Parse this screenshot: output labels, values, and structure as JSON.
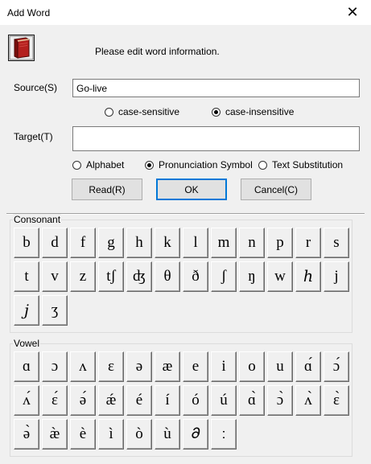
{
  "window": {
    "title": "Add Word",
    "close_label": "✕"
  },
  "header": {
    "prompt": "Please edit word information."
  },
  "source": {
    "label": "Source(S)",
    "value": "Go-live"
  },
  "case_options": [
    {
      "label": "case-sensitive",
      "selected": false
    },
    {
      "label": "case-insensitive",
      "selected": true
    }
  ],
  "target": {
    "label": "Target(T)",
    "value": ""
  },
  "type_options": [
    {
      "label": "Alphabet",
      "selected": false
    },
    {
      "label": "Pronunciation Symbol",
      "selected": true
    },
    {
      "label": "Text Substitution",
      "selected": false
    }
  ],
  "buttons": {
    "read": "Read(R)",
    "ok": "OK",
    "cancel": "Cancel(C)"
  },
  "consonant": {
    "title": "Consonant",
    "symbols": [
      "b",
      "d",
      "f",
      "g",
      "h",
      "k",
      "l",
      "m",
      "n",
      "p",
      "r",
      "s",
      "t",
      "v",
      "z",
      "tʃ",
      "ʤ",
      "θ",
      "ð",
      "ʃ",
      "ŋ",
      "w",
      "ℎ",
      "j",
      "𝑗",
      "ʒ"
    ]
  },
  "vowel": {
    "title": "Vowel",
    "symbols": [
      "ɑ",
      "ɔ",
      "ʌ",
      "ɛ",
      "ə",
      "æ",
      "e",
      "i",
      "o",
      "u",
      "ɑ́",
      "ɔ́",
      "ʌ́",
      "ɛ́",
      "ə́",
      "ǽ",
      "é",
      "í",
      "ó",
      "ú",
      "ɑ̀",
      "ɔ̀",
      "ʌ̀",
      "ɛ̀",
      "ə̀",
      "æ̀",
      "è",
      "ì",
      "ò",
      "ù",
      "𝜕",
      "ː"
    ]
  }
}
